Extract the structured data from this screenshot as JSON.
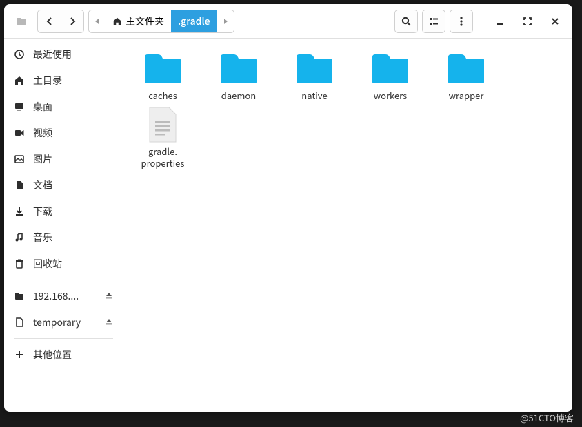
{
  "path": {
    "root_label": "主文件夹",
    "current_label": ".gradle"
  },
  "sidebar": {
    "items": [
      {
        "icon": "clock",
        "label": "最近使用"
      },
      {
        "icon": "home",
        "label": "主目录"
      },
      {
        "icon": "desktop",
        "label": "桌面"
      },
      {
        "icon": "video",
        "label": "视频"
      },
      {
        "icon": "image",
        "label": "图片"
      },
      {
        "icon": "doc",
        "label": "文档"
      },
      {
        "icon": "download",
        "label": "下载"
      },
      {
        "icon": "music",
        "label": "音乐"
      },
      {
        "icon": "trash",
        "label": "回收站"
      }
    ],
    "mounts": [
      {
        "icon": "folder",
        "label": "192.168....",
        "eject": true
      },
      {
        "icon": "file",
        "label": "temporary",
        "eject": true
      }
    ],
    "other": {
      "icon": "plus",
      "label": "其他位置"
    }
  },
  "files": [
    {
      "type": "folder",
      "name": "caches"
    },
    {
      "type": "folder",
      "name": "daemon"
    },
    {
      "type": "folder",
      "name": "native"
    },
    {
      "type": "folder",
      "name": "workers"
    },
    {
      "type": "folder",
      "name": "wrapper"
    },
    {
      "type": "file",
      "name": "gradle.\nproperties"
    }
  ],
  "colors": {
    "folder": "#15b3ec",
    "accent": "#2d9fe0"
  },
  "watermark": "@51CTO博客"
}
